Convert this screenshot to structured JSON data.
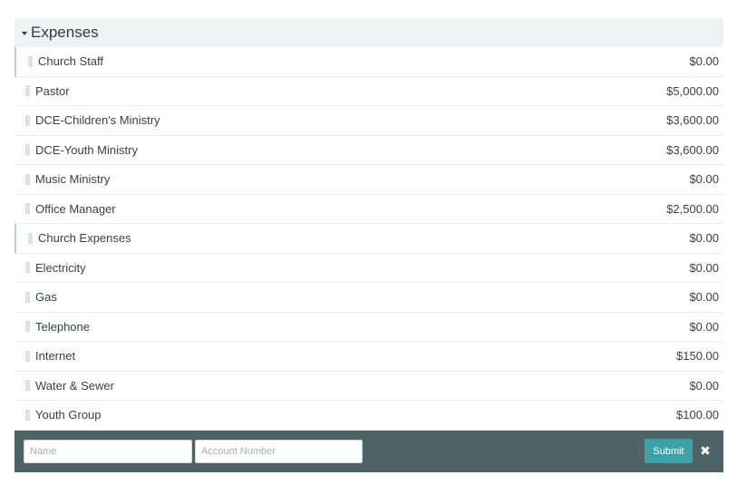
{
  "section": {
    "title": "Expenses"
  },
  "rows": [
    {
      "name": "Church Staff",
      "amount": "$0.00",
      "group": true
    },
    {
      "name": "Pastor",
      "amount": "$5,000.00",
      "group": false
    },
    {
      "name": "DCE-Children's Ministry",
      "amount": "$3,600.00",
      "group": false
    },
    {
      "name": "DCE-Youth Ministry",
      "amount": "$3,600.00",
      "group": false
    },
    {
      "name": "Music Ministry",
      "amount": "$0.00",
      "group": false
    },
    {
      "name": "Office Manager",
      "amount": "$2,500.00",
      "group": false
    },
    {
      "name": "Church Expenses",
      "amount": "$0.00",
      "group": true
    },
    {
      "name": "Electricity",
      "amount": "$0.00",
      "group": false
    },
    {
      "name": "Gas",
      "amount": "$0.00",
      "group": false
    },
    {
      "name": "Telephone",
      "amount": "$0.00",
      "group": false
    },
    {
      "name": "Internet",
      "amount": "$150.00",
      "group": false
    },
    {
      "name": "Water & Sewer",
      "amount": "$0.00",
      "group": false
    },
    {
      "name": "Youth Group",
      "amount": "$100.00",
      "group": false
    }
  ],
  "form": {
    "name_placeholder": "Name",
    "name_value": "",
    "account_placeholder": "Account Number",
    "account_value": "",
    "submit_label": "Submit",
    "close_glyph": "✖"
  },
  "colors": {
    "header_bg": "#eef2f2",
    "form_bg": "#4d6366",
    "submit_bg": "#3aa2a8",
    "group_marker": "#b8cfd2"
  },
  "icons": {
    "caret": "caret-down-icon",
    "grip": "drag-handle-icon",
    "close": "close-icon"
  }
}
